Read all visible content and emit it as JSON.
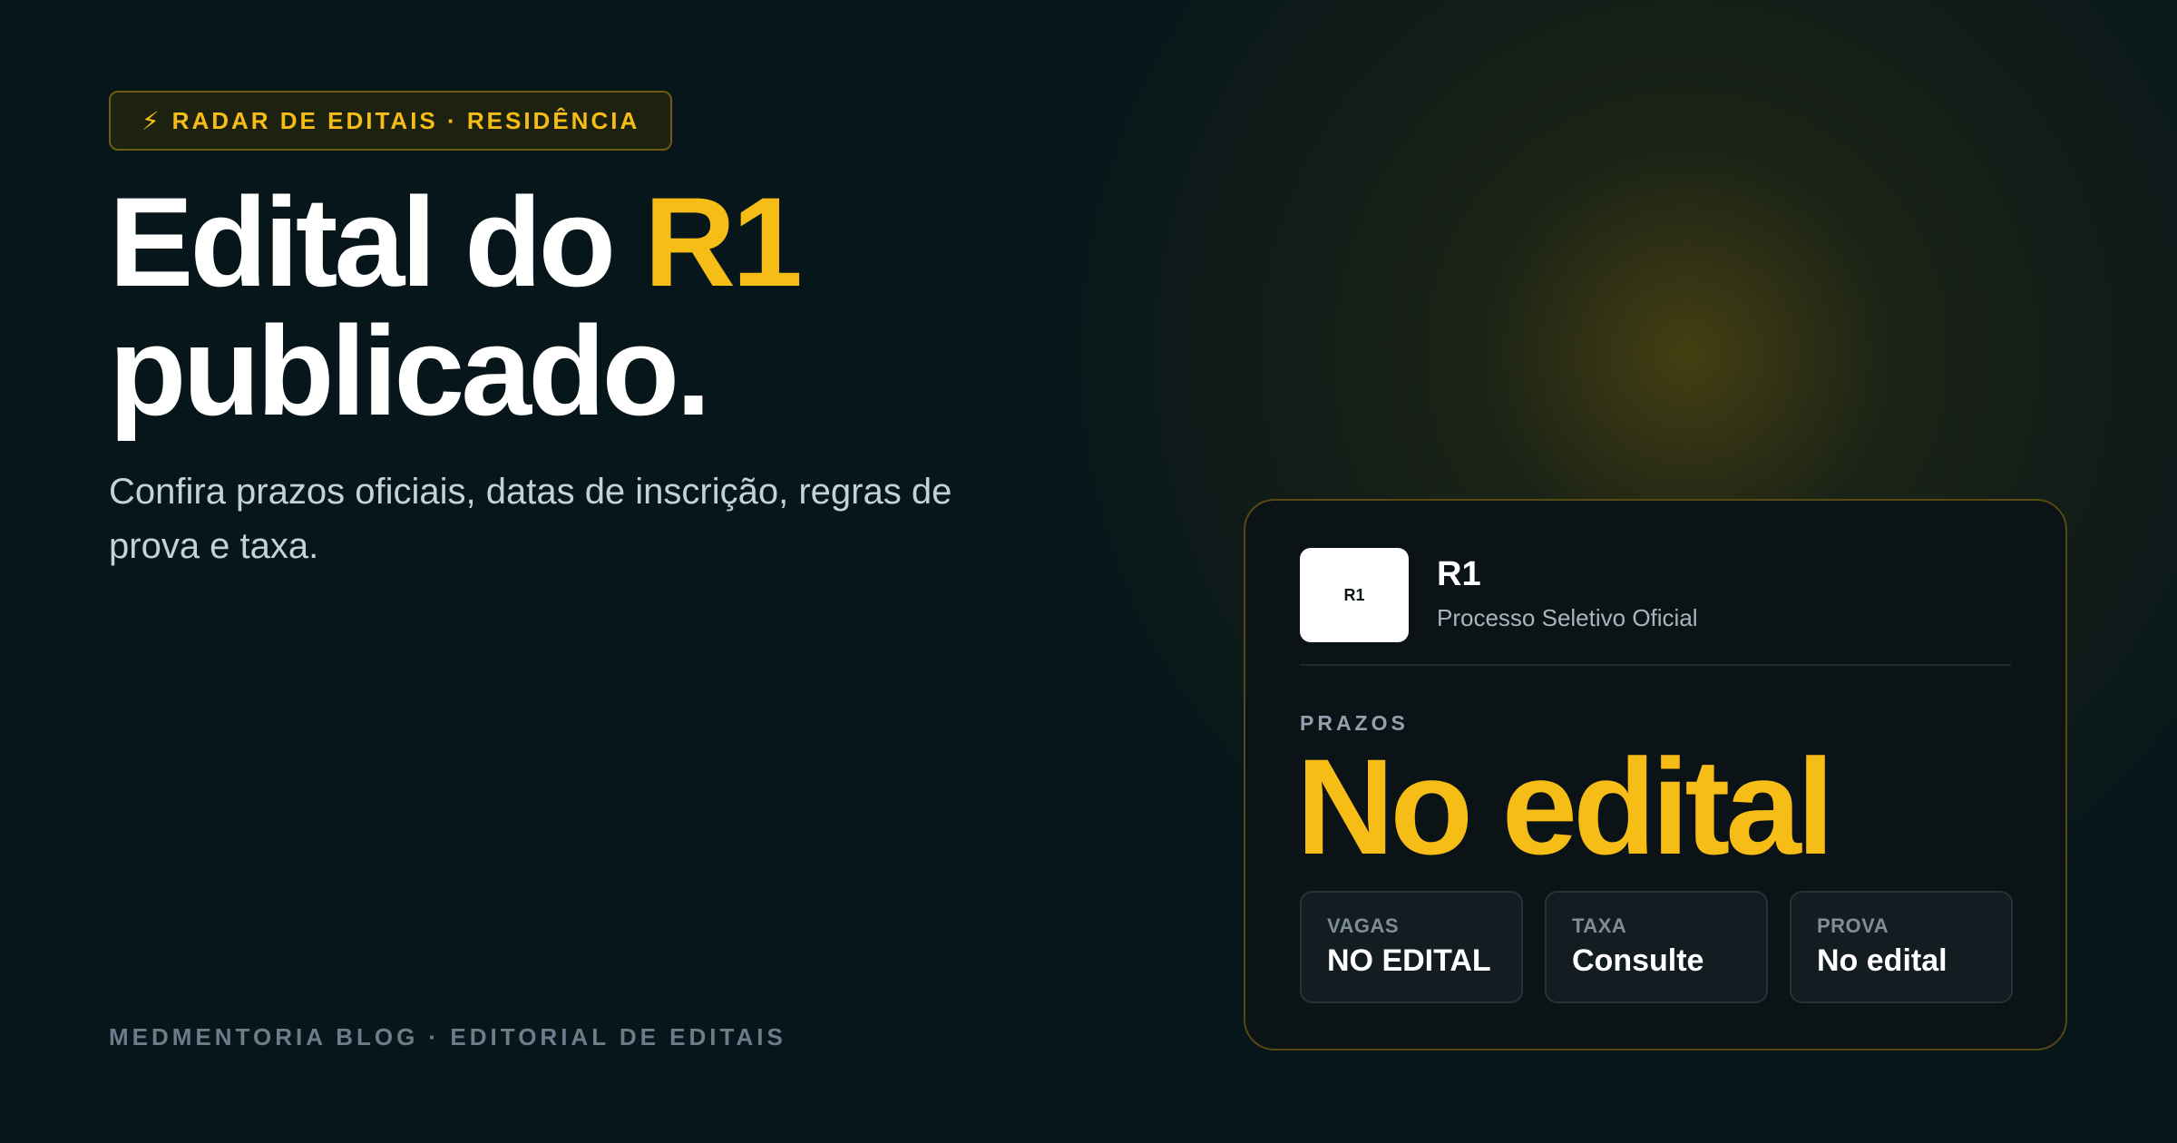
{
  "badge": {
    "icon": "lightning-bolt-icon",
    "glyph": "⚡",
    "text": "RADAR DE EDITAIS · RESIDÊNCIA"
  },
  "headline": {
    "part1": "Edital do ",
    "accent": "R1",
    "line2": "publicado."
  },
  "subtitle": "Confira prazos oficiais, datas de inscrição, regras de prova e taxa.",
  "footer": {
    "brand": "MEDMENTORIA BLOG · EDITORIAL DE EDITAIS"
  },
  "card": {
    "logo_text": "R1",
    "title": "R1",
    "subtitle": "Processo Seletivo Oficial",
    "prazos_label": "PRAZOS",
    "prazos_value": "No edital",
    "stats": [
      {
        "label": "VAGAS",
        "value": "NO EDITAL"
      },
      {
        "label": "TAXA",
        "value": "Consulte"
      },
      {
        "label": "PROVA",
        "value": "No edital"
      }
    ]
  },
  "colors": {
    "background": "#07161a",
    "accent": "#f6bd16",
    "card": "#0b1316",
    "text": "#ffffff"
  }
}
